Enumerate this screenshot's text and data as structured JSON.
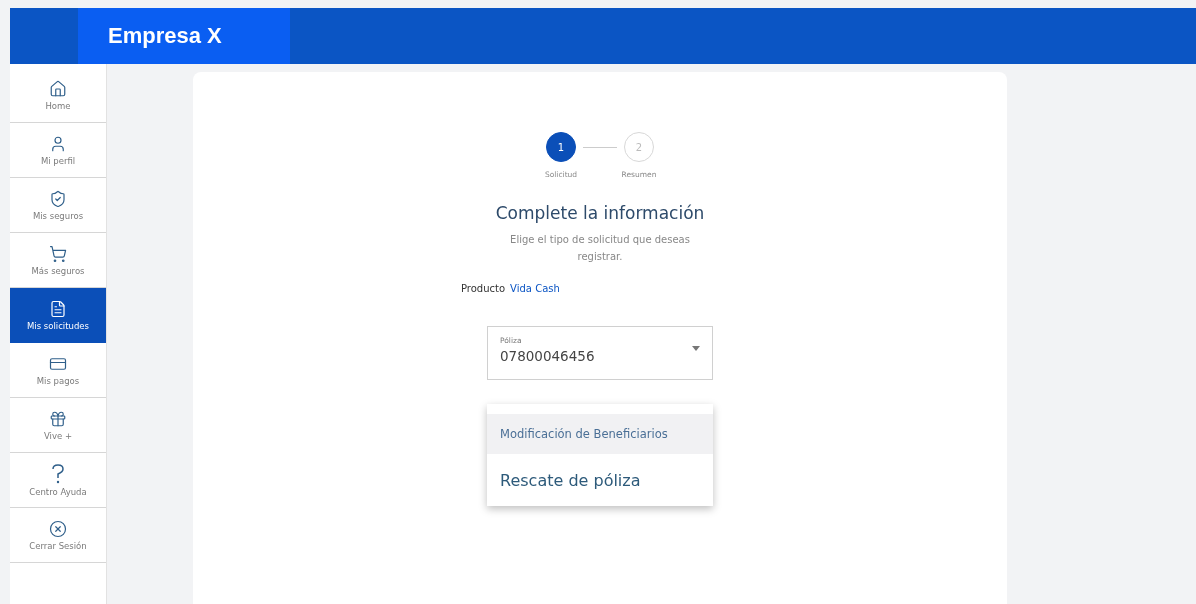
{
  "header": {
    "brand": "Empresa X"
  },
  "sidebar": {
    "items": [
      {
        "kind": "home",
        "label": "Home",
        "selected": false
      },
      {
        "kind": "profile",
        "label": "Mi perfil",
        "selected": false
      },
      {
        "kind": "shield",
        "label": "Mis seguros",
        "selected": false
      },
      {
        "kind": "cart",
        "label": "Más seguros",
        "selected": false
      },
      {
        "kind": "document",
        "label": "Mis solicitudes",
        "selected": true
      },
      {
        "kind": "card",
        "label": "Mis pagos",
        "selected": false
      },
      {
        "kind": "gift",
        "label": "Vive +",
        "selected": false
      },
      {
        "kind": "help",
        "label": "Centro Ayuda",
        "selected": false
      },
      {
        "kind": "logout",
        "label": "Cerrar Sesión",
        "selected": false
      }
    ]
  },
  "stepper": {
    "steps": [
      {
        "number": "1",
        "label": "Solicitud",
        "selected": true
      },
      {
        "number": "2",
        "label": "Resumen",
        "selected": false
      }
    ]
  },
  "form": {
    "title": "Complete la información",
    "subtitle": "Elige el tipo de solicitud que deseas registrar.",
    "product_label": "Producto",
    "product_value": "Vida Cash",
    "policy_field": {
      "label": "Póliza",
      "value": "07800046456"
    },
    "menu": [
      {
        "label": "Modificación de Beneficiarios",
        "selected": true
      },
      {
        "label": "Rescate de póliza",
        "selected": false
      }
    ]
  }
}
